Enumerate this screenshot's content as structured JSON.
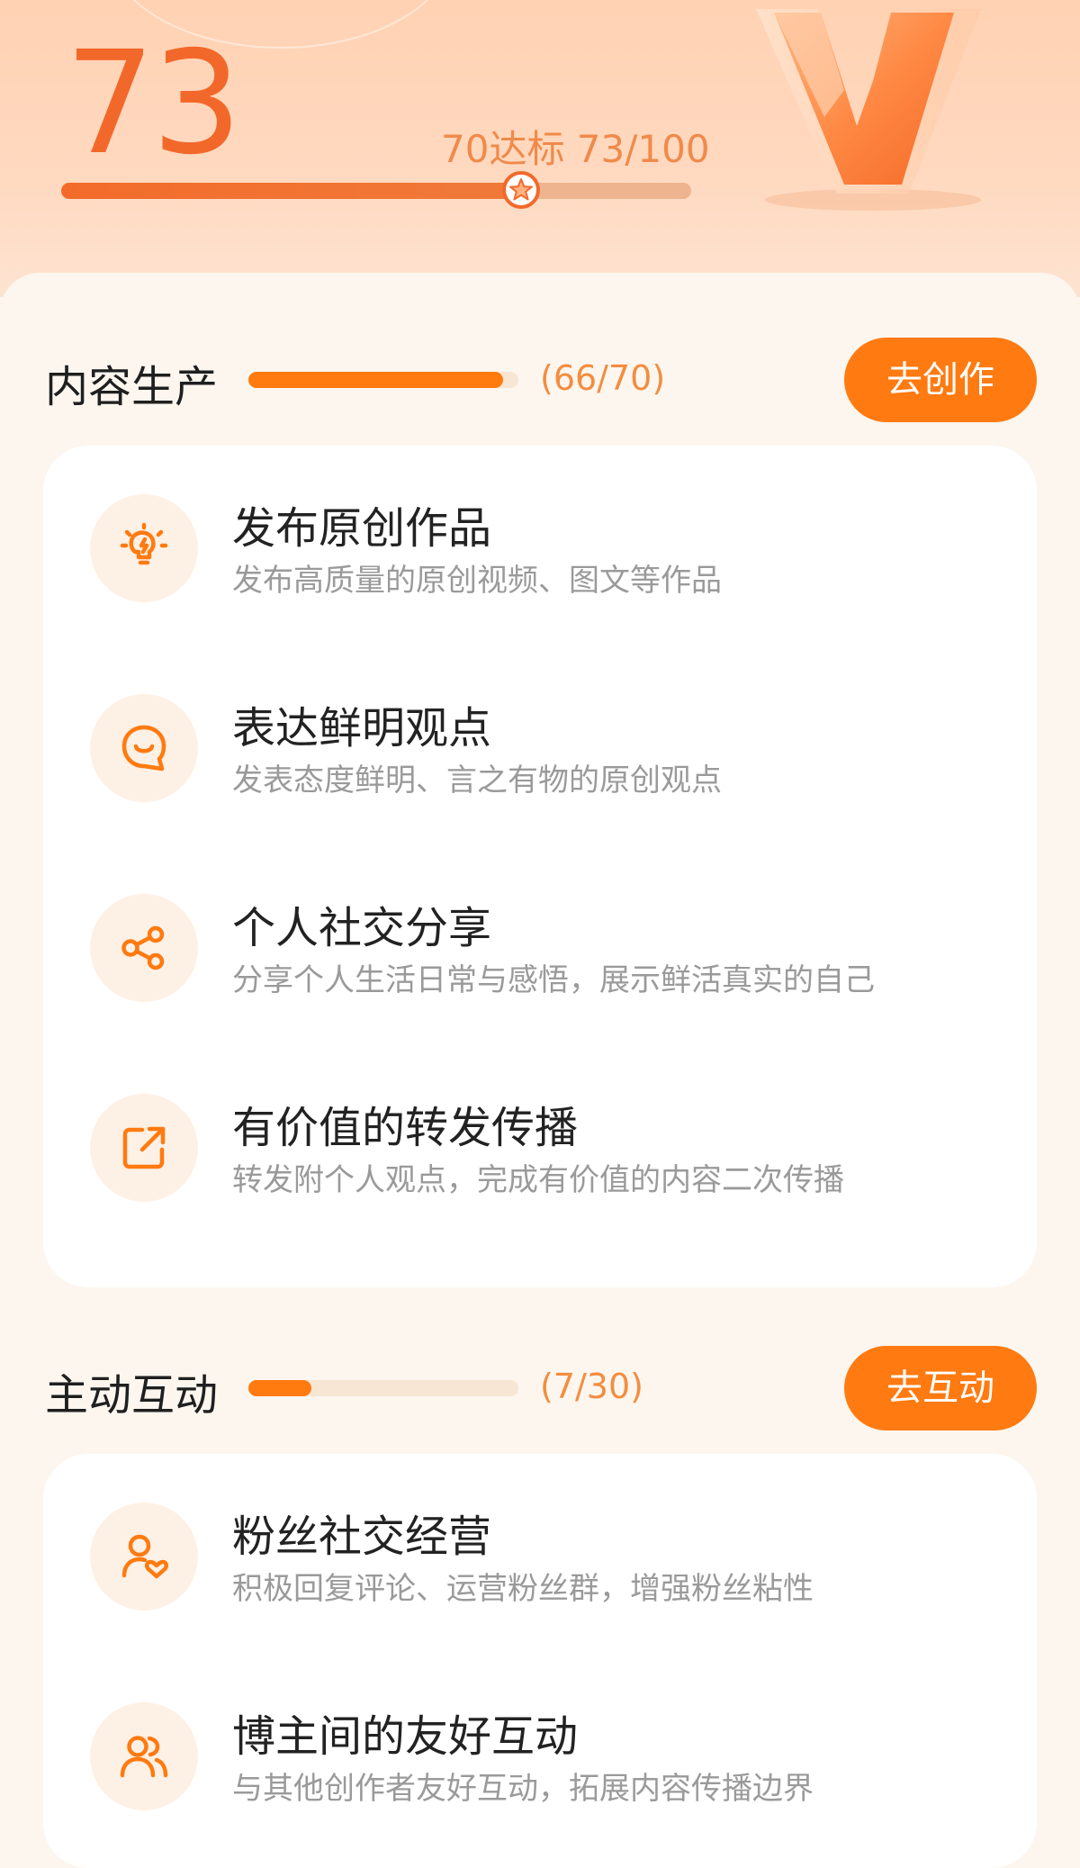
{
  "score": {
    "value": "73",
    "target_text": "70达标 73/100",
    "current": 73,
    "target": 70,
    "max": 100
  },
  "colors": {
    "accent": "#ff7a10",
    "score_orange": "#f2682a",
    "muted_text": "#9a9a9a"
  },
  "sections": [
    {
      "title": "内容生产",
      "progress_text": "(66/70)",
      "progress_fraction": 0.943,
      "button_label": "去创作",
      "items": [
        {
          "icon": "lightbulb-icon",
          "title": "发布原创作品",
          "desc": "发布高质量的原创视频、图文等作品"
        },
        {
          "icon": "chat-smile-icon",
          "title": "表达鲜明观点",
          "desc": "发表态度鲜明、言之有物的原创观点"
        },
        {
          "icon": "share-icon",
          "title": "个人社交分享",
          "desc": "分享个人生活日常与感悟，展示鲜活真实的自己"
        },
        {
          "icon": "forward-icon",
          "title": "有价值的转发传播",
          "desc": "转发附个人观点，完成有价值的内容二次传播"
        }
      ]
    },
    {
      "title": "主动互动",
      "progress_text": "(7/30)",
      "progress_fraction": 0.233,
      "button_label": "去互动",
      "items": [
        {
          "icon": "fan-heart-icon",
          "title": "粉丝社交经营",
          "desc": "积极回复评论、运营粉丝群，增强粉丝粘性"
        },
        {
          "icon": "users-icon",
          "title": "博主间的友好互动",
          "desc": "与其他创作者友好互动，拓展内容传播边界"
        }
      ]
    }
  ]
}
